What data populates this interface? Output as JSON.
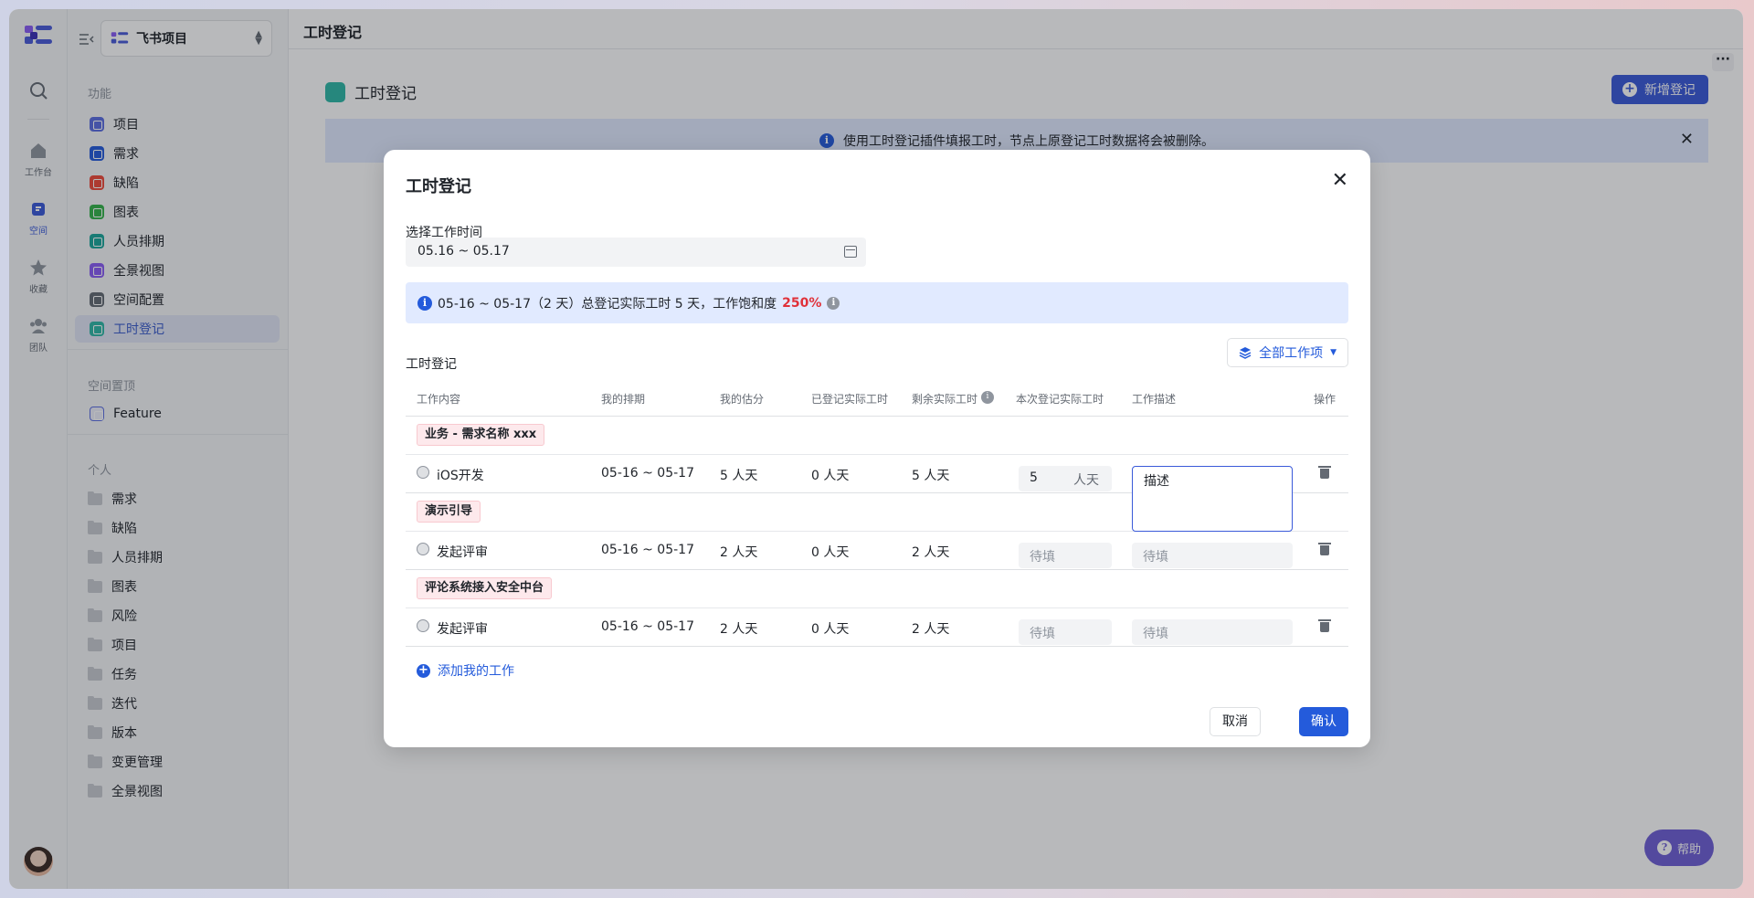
{
  "rail": {
    "items": [
      {
        "label": ""
      },
      {
        "label": "工作台"
      },
      {
        "label": "空间"
      },
      {
        "label": "收藏"
      },
      {
        "label": "团队"
      }
    ]
  },
  "sidebar": {
    "project": "飞书项目",
    "section_features": "功能",
    "features": [
      {
        "label": "项目",
        "color": "#5b6ee1"
      },
      {
        "label": "需求",
        "color": "#245bdb"
      },
      {
        "label": "缺陷",
        "color": "#f04a3a"
      },
      {
        "label": "图表",
        "color": "#34b34a"
      },
      {
        "label": "人员排期",
        "color": "#1aa69b"
      },
      {
        "label": "全景视图",
        "color": "#8a5cf5"
      },
      {
        "label": "空间配置",
        "color": "#646a73"
      },
      {
        "label": "工时登记",
        "color": "#2eb8a6"
      }
    ],
    "section_pinned": "空间置顶",
    "pinned": [
      {
        "label": "Feature"
      }
    ],
    "section_personal": "个人",
    "personal": [
      {
        "label": "需求"
      },
      {
        "label": "缺陷"
      },
      {
        "label": "人员排期"
      },
      {
        "label": "图表"
      },
      {
        "label": "风险"
      },
      {
        "label": "项目"
      },
      {
        "label": "任务"
      },
      {
        "label": "迭代"
      },
      {
        "label": "版本"
      },
      {
        "label": "变更管理"
      },
      {
        "label": "全景视图"
      }
    ]
  },
  "main": {
    "topbar_title": "工时登记",
    "page_title": "工时登记",
    "new_button": "新增登记",
    "banner_text": "使用工时登记插件填报工时，节点上原登记工时数据将会被删除。",
    "help": "帮助"
  },
  "modal": {
    "title": "工时登记",
    "time_label": "选择工作时间",
    "date_range": "05.16 ~ 05.17",
    "summary_text": "05-16 ~ 05-17（2 天）总登记实际工时 5 天，工作饱和度",
    "summary_pct": "250%",
    "section_label": "工时登记",
    "filter_button": "全部工作项",
    "columns": [
      "工作内容",
      "我的排期",
      "我的估分",
      "已登记实际工时",
      "剩余实际工时",
      "本次登记实际工时",
      "工作描述",
      "操作"
    ],
    "groups": [
      {
        "tag": "业务 - 需求名称 xxx",
        "rows": [
          {
            "name": "iOS开发",
            "schedule": "05-16 ~ 05-17",
            "estimate": "5 人天",
            "logged": "0 人天",
            "remaining": "5 人天",
            "entry": "5",
            "unit": "人天",
            "desc": "描述"
          }
        ]
      },
      {
        "tag": "演示引导",
        "rows": [
          {
            "name": "发起评审",
            "schedule": "05-16 ~ 05-17",
            "estimate": "2 人天",
            "logged": "0 人天",
            "remaining": "2 人天",
            "entry": "待填",
            "desc": "待填"
          }
        ]
      },
      {
        "tag": "评论系统接入安全中台",
        "rows": [
          {
            "name": "发起评审",
            "schedule": "05-16 ~ 05-17",
            "estimate": "2 人天",
            "logged": "0 人天",
            "remaining": "2 人天",
            "entry": "待填",
            "desc": "待填"
          }
        ]
      }
    ],
    "add_work": "添加我的工作",
    "cancel": "取消",
    "confirm": "确认"
  }
}
